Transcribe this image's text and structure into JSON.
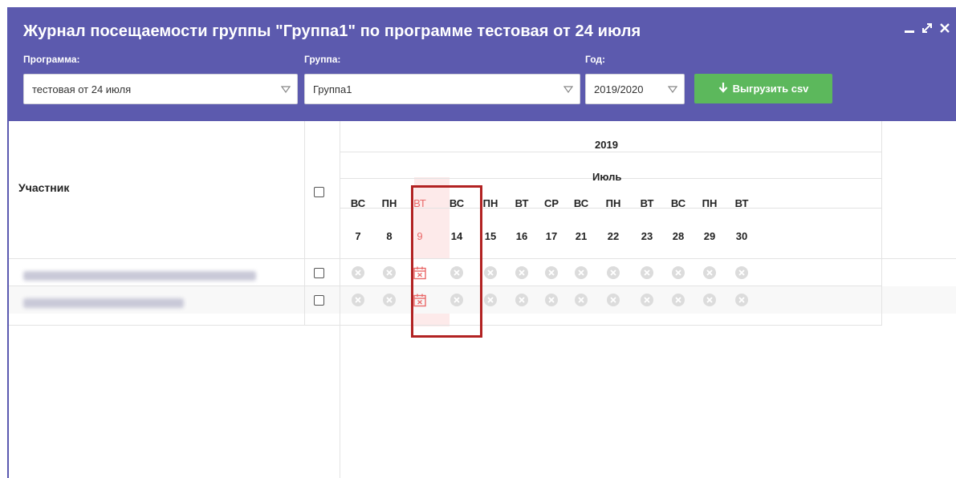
{
  "window": {
    "title": "Журнал посещаемости группы \"Группа1\" по программе тестовая от 24 июля",
    "controls": [
      "minimize-icon",
      "expand-icon",
      "close-icon"
    ]
  },
  "filters": {
    "program_label": "Программа:",
    "program_value": "тестовая от 24 июля",
    "group_label": "Группа:",
    "group_value": "Группа1",
    "year_label": "Год:",
    "year_value": "2019/2020",
    "export_button": "Выгрузить csv"
  },
  "table": {
    "participant_header": "Участник",
    "year": "2019",
    "month": "Июль",
    "days": [
      {
        "weekday": "ВС",
        "day": "7"
      },
      {
        "weekday": "ПН",
        "day": "8"
      },
      {
        "weekday": "ВТ",
        "day": "9",
        "highlighted": true
      },
      {
        "weekday": "ВС",
        "day": "14"
      },
      {
        "weekday": "ПН",
        "day": "15"
      },
      {
        "weekday": "ВТ",
        "day": "16"
      },
      {
        "weekday": "СР",
        "day": "17"
      },
      {
        "weekday": "ВС",
        "day": "21"
      },
      {
        "weekday": "ПН",
        "day": "22"
      },
      {
        "weekday": "ВТ",
        "day": "23"
      },
      {
        "weekday": "ВС",
        "day": "28"
      },
      {
        "weekday": "ПН",
        "day": "29"
      },
      {
        "weekday": "ВТ",
        "day": "30"
      }
    ],
    "rows": [
      {
        "participant": "",
        "marks": [
          "absent",
          "absent",
          "calendar-x",
          "absent",
          "absent",
          "absent",
          "absent",
          "absent",
          "absent",
          "absent",
          "absent",
          "absent",
          "absent"
        ]
      },
      {
        "participant": "",
        "marks": [
          "absent",
          "absent",
          "calendar-x",
          "absent",
          "absent",
          "absent",
          "absent",
          "absent",
          "absent",
          "absent",
          "absent",
          "absent",
          "absent"
        ]
      }
    ]
  },
  "colors": {
    "header": "#5c5aae",
    "export_button": "#5cb85c",
    "highlight": "#e96a6a",
    "callout": "#b22222"
  }
}
